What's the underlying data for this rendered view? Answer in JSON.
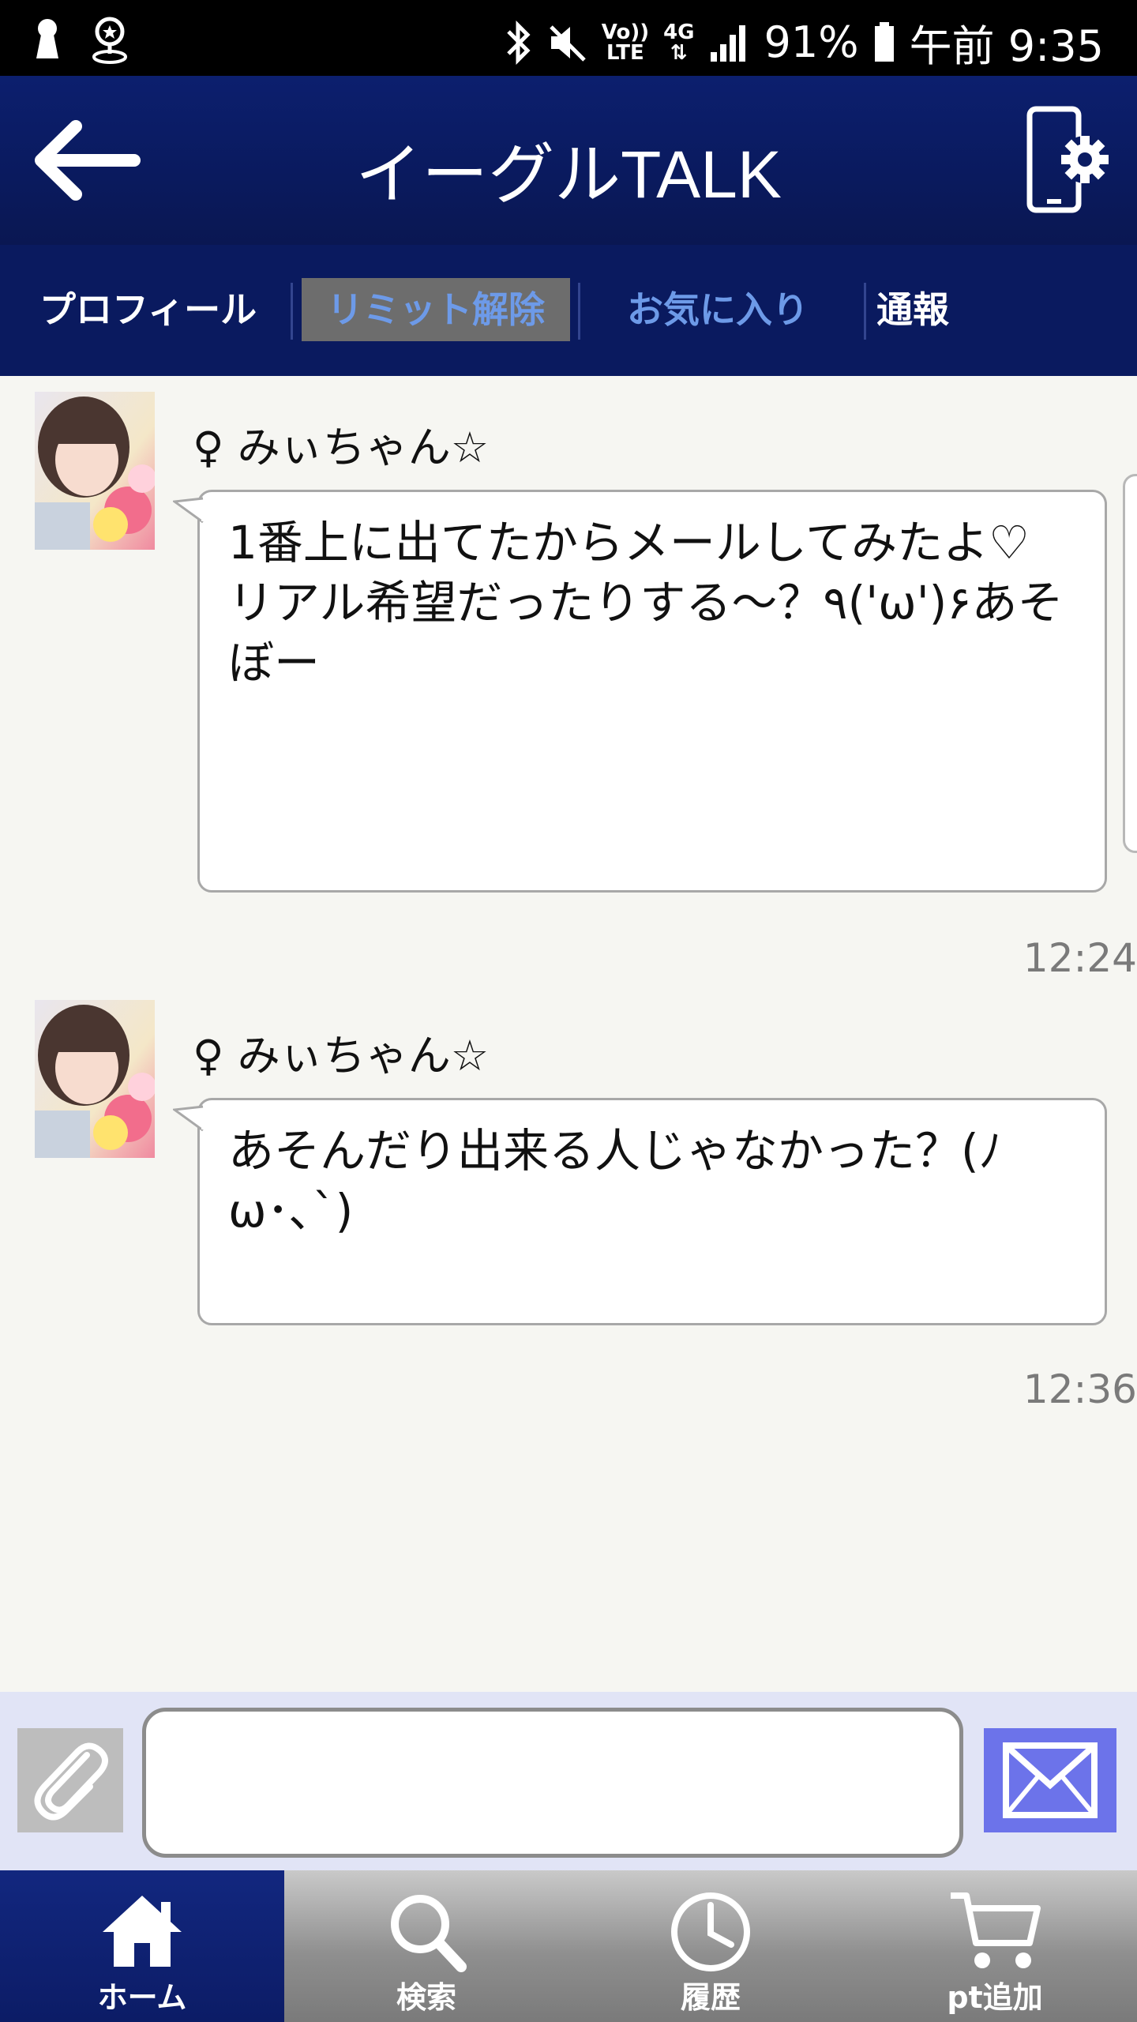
{
  "status_bar": {
    "left_icons": [
      "keyhole-icon",
      "location-pin-icon"
    ],
    "right_icons": [
      "bluetooth-icon",
      "mute-icon",
      "volte-icon",
      "4g-icon",
      "signal-icon",
      "battery-icon"
    ],
    "volte_label_top": "Vo))",
    "volte_label_bottom": "LTE",
    "network_label": "4G",
    "battery": "91%",
    "clock": "午前 9:35"
  },
  "header": {
    "title": "イーグルTALK",
    "back_icon": "arrow-left-icon",
    "settings_icon": "phone-settings-icon"
  },
  "tabs": {
    "profile": "プロフィール",
    "limit": "リミット解除",
    "favorite": "お気に入り",
    "report": "通報"
  },
  "messages": [
    {
      "sender": "♀ みぃちゃん☆",
      "text": "1番上に出てたからメールしてみたよ♡\nリアル希望だったりする～？٩('ω')۶あそぼー",
      "time": "12:24"
    },
    {
      "sender": "♀ みぃちゃん☆",
      "text": "あそんだり出来る人じゃなかった？(ﾉω･､`)",
      "time": "12:36"
    }
  ],
  "input_bar": {
    "attach_icon": "paperclip-icon",
    "send_icon": "envelope-icon",
    "input_value": ""
  },
  "bottom_nav": [
    {
      "label": "ホーム",
      "icon": "home-icon",
      "active": true
    },
    {
      "label": "検索",
      "icon": "search-icon",
      "active": false
    },
    {
      "label": "履歴",
      "icon": "clock-icon",
      "active": false
    },
    {
      "label": "pt追加",
      "icon": "cart-icon",
      "active": false
    }
  ],
  "colors": {
    "header_bg": "#0a1a5e",
    "tab_active_bg": "#6d6d6d",
    "tab_link": "#6d9ae8",
    "send_button": "#6c73ea",
    "page_bg": "#f6f6f2"
  }
}
